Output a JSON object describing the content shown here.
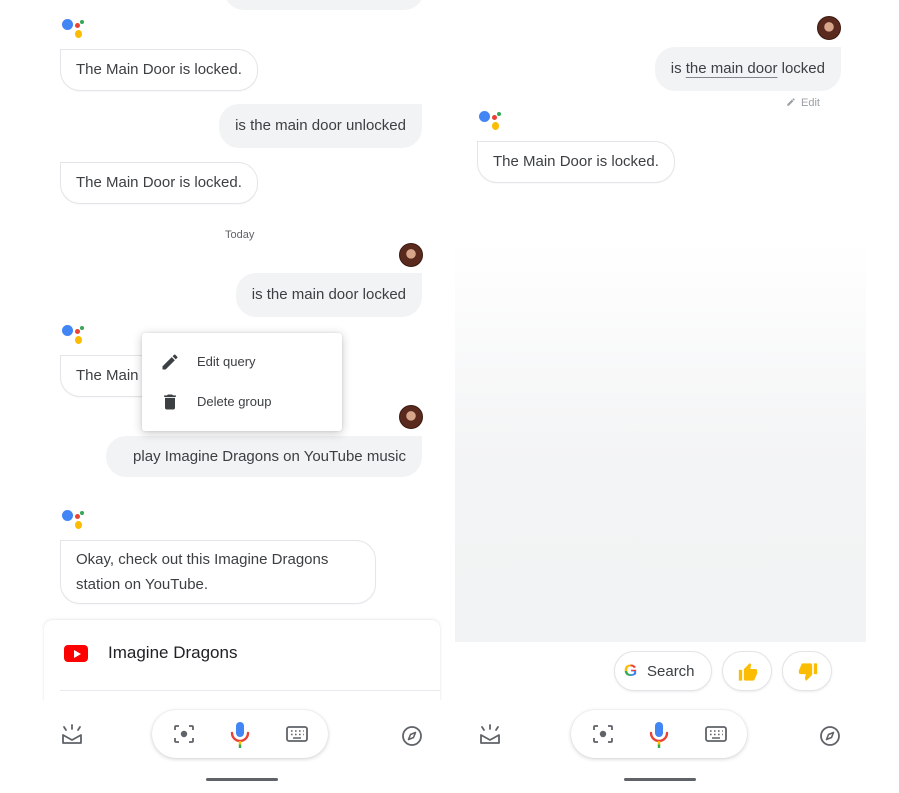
{
  "left": {
    "conversation": {
      "bot_reply_1": "The Main Door is locked.",
      "user_query_1": "is the main door unlocked",
      "bot_reply_2": "The Main Door is locked.",
      "date_divider": "Today",
      "user_query_2": "is the main door locked",
      "bot_reply_3_partial": "The Main",
      "user_query_3": "play Imagine Dragons on YouTube music",
      "bot_reply_4": "Okay, check out this Imagine Dragons station on YouTube."
    },
    "context_menu": {
      "items": [
        {
          "label": "Edit query",
          "icon": "pencil-icon"
        },
        {
          "label": "Delete group",
          "icon": "trash-icon"
        }
      ]
    },
    "card": {
      "title": "Imagine Dragons",
      "icon": "youtube-icon",
      "brand_color": "#ff0000"
    }
  },
  "right": {
    "conversation": {
      "user_query_prefix": "is ",
      "user_query_highlight": "the main door",
      "user_query_suffix": " locked",
      "edit_label": "Edit",
      "bot_reply": "The Main Door is locked."
    },
    "suggestions": {
      "search_label": "Search",
      "thumbs_up_icon": "thumbs-up-icon",
      "thumbs_down_icon": "thumbs-down-icon"
    }
  },
  "bottom_bar": {
    "icons": [
      "updates-icon",
      "lens-icon",
      "mic-icon",
      "keyboard-icon",
      "explore-icon"
    ]
  },
  "colors": {
    "google_blue": "#4285f4",
    "google_red": "#ea4335",
    "google_yellow": "#fbbc04",
    "google_green": "#34a853",
    "bubble_gray": "#f1f3f4",
    "text": "#3c4043"
  }
}
